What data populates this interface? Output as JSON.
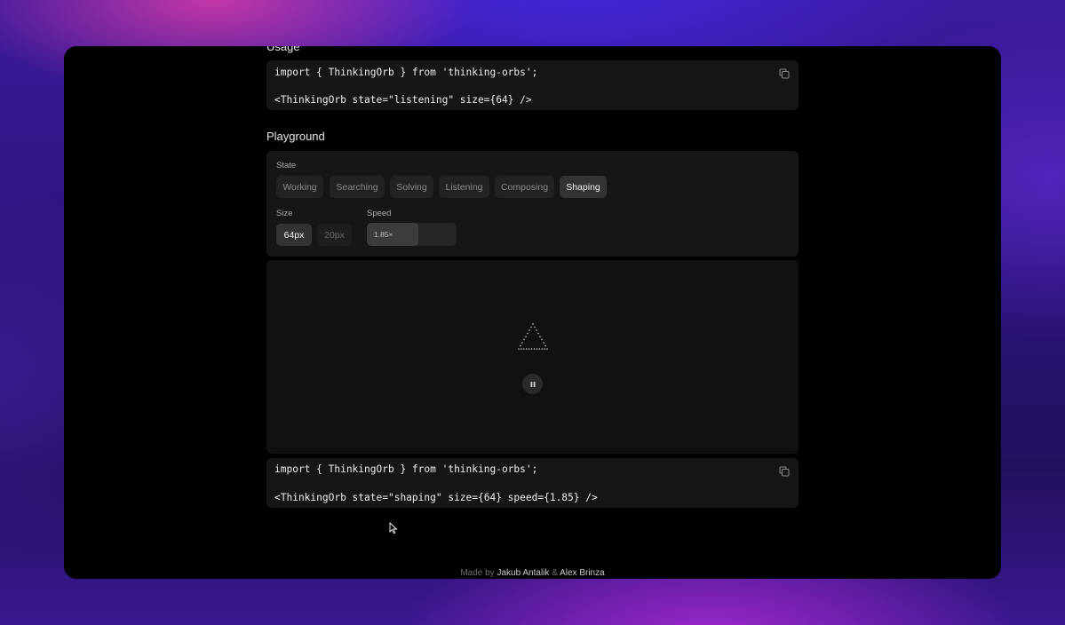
{
  "usage": {
    "title": "Usage",
    "code_line1": "import { ThinkingOrb } from 'thinking-orbs';",
    "code_line2": "<ThinkingOrb state=\"listening\" size={64} />"
  },
  "playground": {
    "title": "Playground",
    "state_label": "State",
    "states": [
      "Working",
      "Searching",
      "Solving",
      "Listening",
      "Composing",
      "Shaping"
    ],
    "active_state": "Shaping",
    "size_label": "Size",
    "sizes": [
      "64px",
      "20px"
    ],
    "active_size": "64px",
    "speed_label": "Speed",
    "speed_value": "1.85×",
    "speed_fraction": 0.57
  },
  "output": {
    "code_line1": "import { ThinkingOrb } from 'thinking-orbs';",
    "code_line2": "<ThinkingOrb state=\"shaping\" size={64} speed={1.85} />"
  },
  "footer": {
    "prefix": "Made by",
    "author1": "Jakub Antalik",
    "separator": "&",
    "author2": "Alex Brinza"
  },
  "icons": {
    "copy": "copy-icon",
    "pause": "pause-icon",
    "orb": "triangle-dots-icon"
  }
}
